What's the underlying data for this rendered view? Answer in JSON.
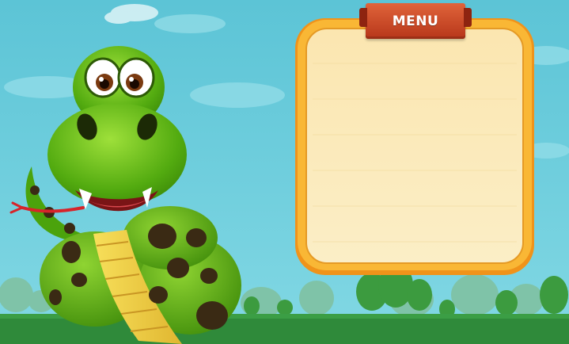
{
  "menu": {
    "title": "MENU"
  },
  "colors": {
    "sky": "#5ec8d8",
    "panel_border": "#f5a623",
    "panel_fill": "#fbe8b2",
    "ribbon": "#c9431f",
    "snake_green": "#4ba30c",
    "grass": "#2f8a3a"
  },
  "icons": [
    "snake-mascot",
    "cloud",
    "tree"
  ]
}
